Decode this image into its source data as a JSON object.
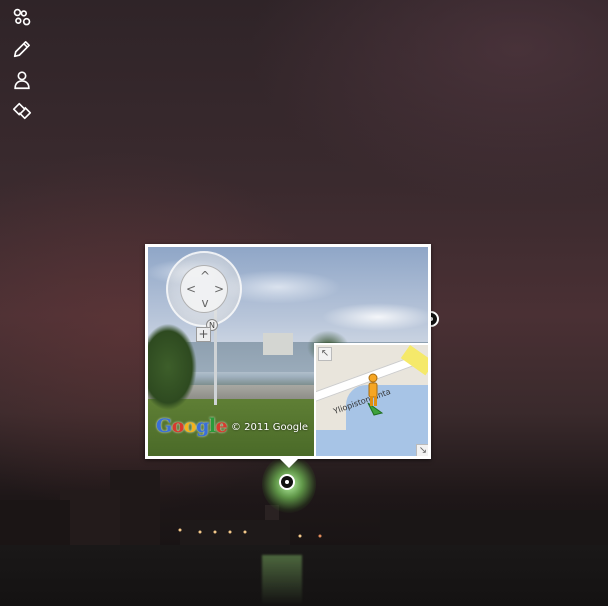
{
  "toolbar": {
    "items": [
      {
        "icon": "network-icon"
      },
      {
        "icon": "pencil-icon"
      },
      {
        "icon": "user-icon"
      },
      {
        "icon": "layers-icon"
      }
    ]
  },
  "popup": {
    "streetview": {
      "copyright": "© 2011 Google",
      "logo_letters": [
        "G",
        "o",
        "o",
        "g",
        "l",
        "e"
      ],
      "logo_colors": [
        "#3a6fd8",
        "#d73a2e",
        "#f3b21b",
        "#3a6fd8",
        "#2a9a3a",
        "#d73a2e"
      ],
      "compass_label": "N",
      "zoom_in_label": "+",
      "nav_arrows": [
        "^",
        "v",
        "<",
        ">"
      ]
    },
    "minimap": {
      "street_label": "Yliopistonranta",
      "expand_label": "↖",
      "resize_label": "↘"
    }
  }
}
